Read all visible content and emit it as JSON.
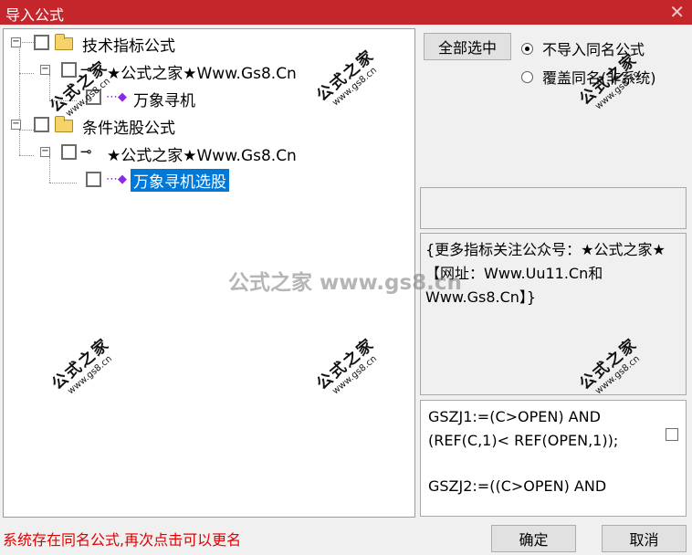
{
  "window": {
    "title": "导入公式",
    "close_glyph": "✕"
  },
  "tree": {
    "nodes": [
      {
        "label": "技术指标公式",
        "icon": "folder-icon",
        "expander": "−",
        "checked": false
      },
      {
        "label": "★公式之家★Www.Gs8.Cn",
        "icon": "key-icon",
        "expander": "−",
        "checked": false
      },
      {
        "label": "万象寻机",
        "icon": "formula-gem-icon",
        "checked": false
      },
      {
        "label": "条件选股公式",
        "icon": "folder-icon",
        "expander": "−",
        "checked": false
      },
      {
        "label": "★公式之家★Www.Gs8.Cn",
        "icon": "key-icon",
        "expander": "−",
        "checked": false
      },
      {
        "label": "万象寻机选股",
        "icon": "formula-gem-icon",
        "checked": false,
        "selected": true
      }
    ]
  },
  "actions": {
    "select_all_label": "全部选中",
    "ok_label": "确定",
    "cancel_label": "取消"
  },
  "options": {
    "radio_no_import_label": "不导入同名公式",
    "radio_overwrite_label": "覆盖同名(非系统)",
    "selected": "no_import"
  },
  "info": {
    "note": "{更多指标关注公众号：★公式之家★【网址：Www.Uu11.Cn和Www.Gs8.Cn】}"
  },
  "code": {
    "line1": "GSZJ1:=(C>OPEN) AND",
    "line2": "(REF(C,1)< REF(OPEN,1));",
    "line3": "GSZJ2:=((C>OPEN) AND"
  },
  "status": {
    "message": "系统存在同名公式,再次点击可以更名"
  },
  "watermark": {
    "center": "公式之家 www.gs8.cn",
    "stamp_title": "公式之家",
    "stamp_url": "www.gs8.cn"
  },
  "colors": {
    "titlebar": "#c4262c",
    "selection": "#0078d7",
    "status_text": "#e00000"
  }
}
